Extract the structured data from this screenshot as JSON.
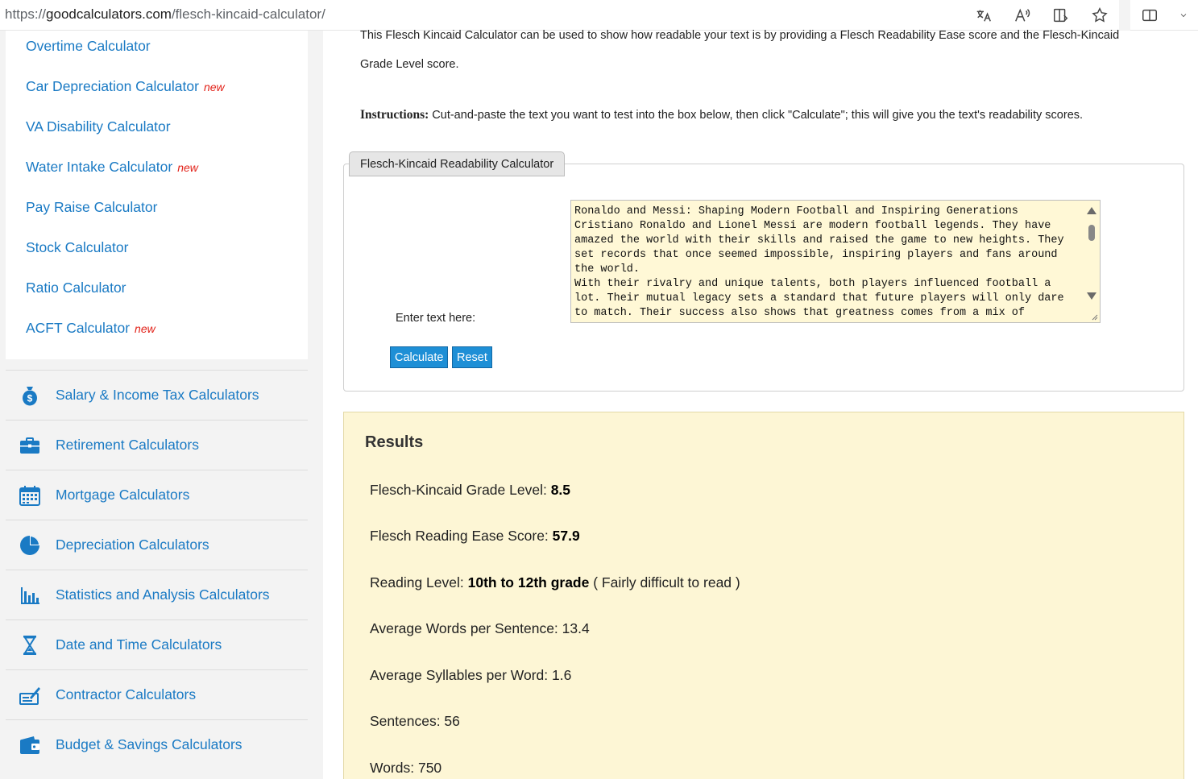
{
  "browser": {
    "url_prefix": "https://",
    "url_host": "goodcalculators.com",
    "url_path": "/flesch-kincaid-calculator/"
  },
  "sidebar": {
    "sub_links": [
      {
        "label": "Overtime Calculator",
        "new": ""
      },
      {
        "label": "Car Depreciation Calculator",
        "new": "new"
      },
      {
        "label": "VA Disability Calculator",
        "new": ""
      },
      {
        "label": "Water Intake Calculator",
        "new": "new"
      },
      {
        "label": "Pay Raise Calculator",
        "new": ""
      },
      {
        "label": "Stock Calculator",
        "new": ""
      },
      {
        "label": "Ratio Calculator",
        "new": ""
      },
      {
        "label": "ACFT Calculator",
        "new": "new"
      }
    ],
    "categories": [
      {
        "label": "Salary & Income Tax Calculators",
        "icon": "money-bag-icon"
      },
      {
        "label": "Retirement Calculators",
        "icon": "briefcase-icon"
      },
      {
        "label": "Mortgage Calculators",
        "icon": "calendar-icon"
      },
      {
        "label": "Depreciation Calculators",
        "icon": "pie-chart-icon"
      },
      {
        "label": "Statistics and Analysis Calculators",
        "icon": "bar-chart-icon"
      },
      {
        "label": "Date and Time Calculators",
        "icon": "hourglass-icon"
      },
      {
        "label": "Contractor Calculators",
        "icon": "contract-icon"
      },
      {
        "label": "Budget & Savings Calculators",
        "icon": "wallet-icon"
      }
    ],
    "accent": "#1a7ac4",
    "new_color": "#e2231a"
  },
  "main": {
    "intro_line1": "This Flesch Kincaid Calculator can be used to show how readable your text is by providing a Flesch Readability Ease score and the Flesch-Kincaid",
    "intro_line2": "Grade Level score.",
    "instructions_label": "Instructions:",
    "instructions_text": " Cut-and-paste the text you want to test into the box below, then click \"Calculate\"; this will give you the text's readability scores.",
    "calc_tab": "Flesch-Kincaid Readability Calculator",
    "enter_label": "Enter text here:",
    "textarea_lines": [
      "Ronaldo and Messi: Shaping Modern Football and Inspiring Generations",
      "Cristiano Ronaldo and Lionel Messi are modern football legends. They have",
      "amazed the world with their skills and raised the game to new heights. They",
      "set records that once seemed impossible, inspiring players and fans around",
      "the world.",
      "With their rivalry and unique talents, both players influenced football a",
      "lot. Their mutual legacy sets a standard that future players will only dare",
      "to match. Their success also shows that greatness comes from a mix of"
    ],
    "calculate_label": "Calculate",
    "reset_label": "Reset",
    "button_color": "#1e8fd6"
  },
  "results": {
    "title": "Results",
    "fk_grade_label": "Flesch-Kincaid Grade Level: ",
    "fk_grade_value": "8.5",
    "ease_label": "Flesch Reading Ease Score: ",
    "ease_value": "57.9",
    "level_label": "Reading Level: ",
    "level_value": "10th to 12th grade",
    "level_note": " ( Fairly difficult to read )",
    "avg_words_label": "Average Words per Sentence: ",
    "avg_words_value": "13.4",
    "avg_syll_label": "Average Syllables per Word: ",
    "avg_syll_value": "1.6",
    "sentences_label": "Sentences: ",
    "sentences_value": "56",
    "words_label": "Words: ",
    "words_value": "750",
    "background": "#fdf6d5"
  }
}
